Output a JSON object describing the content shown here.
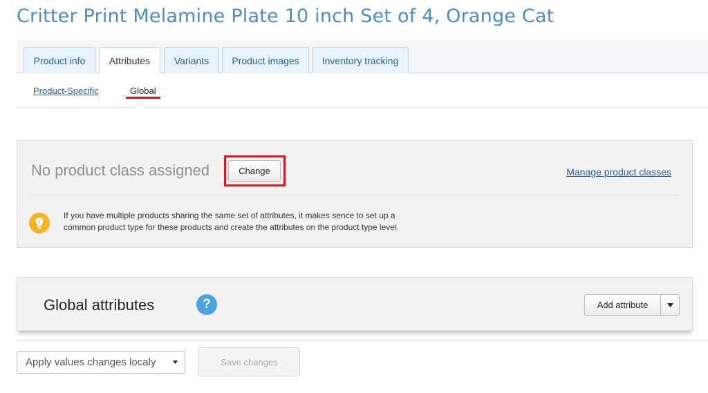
{
  "page": {
    "title": "Critter Print Melamine Plate 10 inch Set of 4, Orange Cat"
  },
  "tabs": [
    {
      "label": "Product info"
    },
    {
      "label": "Attributes"
    },
    {
      "label": "Variants"
    },
    {
      "label": "Product images"
    },
    {
      "label": "Inventory tracking"
    }
  ],
  "active_tab": "Attributes",
  "subtabs": [
    {
      "label": "Product-Specific"
    },
    {
      "label": "Global"
    }
  ],
  "active_subtab": "Global",
  "product_class": {
    "status": "No product class assigned",
    "change_label": "Change",
    "manage_link": "Manage product classes",
    "tip_line1": "If you have multiple products sharing the same set of attributes, it makes sence to set up a",
    "tip_line2": "common product type for these products and create the attributes on the product type level."
  },
  "global_attributes": {
    "title": "Global attributes",
    "help_icon": "question-icon",
    "add_label": "Add attribute"
  },
  "footer": {
    "apply_select_value": "Apply values changes localy",
    "save_label": "Save changes"
  },
  "colors": {
    "title": "#4a8dc0",
    "link": "#2b5f8f",
    "highlight": "#e0141c",
    "tip_icon": "#f5b221",
    "help_icon": "#4aa3df"
  }
}
